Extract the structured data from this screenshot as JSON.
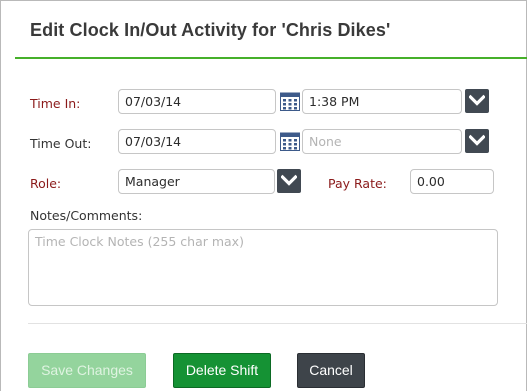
{
  "dialog": {
    "title": "Edit Clock In/Out Activity for 'Chris Dikes'"
  },
  "time_in": {
    "label": "Time In:",
    "date": "07/03/14",
    "time": "1:38 PM"
  },
  "time_out": {
    "label": "Time Out:",
    "date": "07/03/14",
    "time": "None"
  },
  "role": {
    "label": "Role:",
    "value": "Manager"
  },
  "pay_rate": {
    "label": "Pay Rate:",
    "value": "0.00"
  },
  "notes": {
    "label": "Notes/Comments:",
    "placeholder": "Time Clock Notes (255 char max)"
  },
  "buttons": {
    "save": "Save Changes",
    "delete": "Delete Shift",
    "cancel": "Cancel"
  },
  "colors": {
    "accent_green": "#46b02a",
    "required_label": "#8b1a1a",
    "delete_button": "#159234",
    "save_button_disabled": "#94d49d",
    "cancel_button": "#3e444a"
  },
  "icons": {
    "calendar": "calendar-icon",
    "dropdown": "chevron-down-icon"
  }
}
